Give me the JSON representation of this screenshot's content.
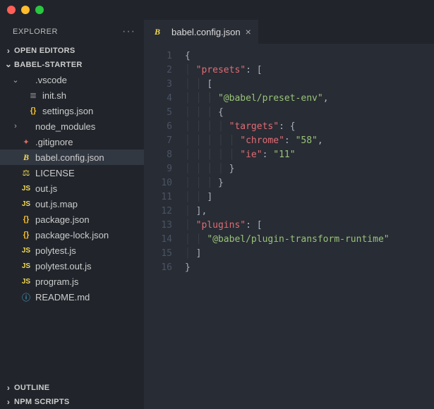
{
  "sidebar": {
    "title": "EXPLORER",
    "sections": {
      "open_editors": "OPEN EDITORS",
      "project": "BABEL-STARTER",
      "outline": "OUTLINE",
      "npm": "NPM SCRIPTS"
    },
    "tree": [
      {
        "name": ".vscode",
        "type": "folder",
        "expanded": true,
        "indent": 1
      },
      {
        "name": "init.sh",
        "type": "sh",
        "indent": 2
      },
      {
        "name": "settings.json",
        "type": "json",
        "indent": 2
      },
      {
        "name": "node_modules",
        "type": "folder",
        "expanded": false,
        "indent": 1
      },
      {
        "name": ".gitignore",
        "type": "git",
        "indent": 1
      },
      {
        "name": "babel.config.json",
        "type": "babel",
        "indent": 1,
        "selected": true
      },
      {
        "name": "LICENSE",
        "type": "license",
        "indent": 1
      },
      {
        "name": "out.js",
        "type": "js",
        "indent": 1
      },
      {
        "name": "out.js.map",
        "type": "js",
        "indent": 1
      },
      {
        "name": "package.json",
        "type": "json",
        "indent": 1
      },
      {
        "name": "package-lock.json",
        "type": "json",
        "indent": 1
      },
      {
        "name": "polytest.js",
        "type": "js",
        "indent": 1
      },
      {
        "name": "polytest.out.js",
        "type": "js",
        "indent": 1
      },
      {
        "name": "program.js",
        "type": "js",
        "indent": 1
      },
      {
        "name": "README.md",
        "type": "info",
        "indent": 1
      }
    ]
  },
  "tab": {
    "label": "babel.config.json"
  },
  "code": {
    "line_count": 16,
    "tokens": [
      [
        {
          "t": "{",
          "c": "punct"
        }
      ],
      [
        {
          "t": "  ",
          "c": "guide"
        },
        {
          "t": "\"presets\"",
          "c": "keyq"
        },
        {
          "t": ": [",
          "c": "punct"
        }
      ],
      [
        {
          "t": "    ",
          "c": "guide"
        },
        {
          "t": "[",
          "c": "punct"
        }
      ],
      [
        {
          "t": "      ",
          "c": "guide"
        },
        {
          "t": "\"@babel/preset-env\"",
          "c": "strq"
        },
        {
          "t": ",",
          "c": "punct"
        }
      ],
      [
        {
          "t": "      ",
          "c": "guide"
        },
        {
          "t": "{",
          "c": "punct"
        }
      ],
      [
        {
          "t": "        ",
          "c": "guide"
        },
        {
          "t": "\"targets\"",
          "c": "keyq"
        },
        {
          "t": ": {",
          "c": "punct"
        }
      ],
      [
        {
          "t": "          ",
          "c": "guide"
        },
        {
          "t": "\"chrome\"",
          "c": "keyq"
        },
        {
          "t": ": ",
          "c": "punct"
        },
        {
          "t": "\"58\"",
          "c": "strq"
        },
        {
          "t": ",",
          "c": "punct"
        }
      ],
      [
        {
          "t": "          ",
          "c": "guide"
        },
        {
          "t": "\"ie\"",
          "c": "keyq"
        },
        {
          "t": ": ",
          "c": "punct"
        },
        {
          "t": "\"11\"",
          "c": "strq"
        }
      ],
      [
        {
          "t": "        ",
          "c": "guide"
        },
        {
          "t": "}",
          "c": "punct"
        }
      ],
      [
        {
          "t": "      ",
          "c": "guide"
        },
        {
          "t": "}",
          "c": "punct"
        }
      ],
      [
        {
          "t": "    ",
          "c": "guide"
        },
        {
          "t": "]",
          "c": "punct"
        }
      ],
      [
        {
          "t": "  ",
          "c": "guide"
        },
        {
          "t": "],",
          "c": "punct"
        }
      ],
      [
        {
          "t": "  ",
          "c": "guide"
        },
        {
          "t": "\"plugins\"",
          "c": "keyq"
        },
        {
          "t": ": [",
          "c": "punct"
        }
      ],
      [
        {
          "t": "    ",
          "c": "guide"
        },
        {
          "t": "\"@babel/plugin-transform-runtime\"",
          "c": "strq"
        }
      ],
      [
        {
          "t": "  ",
          "c": "guide"
        },
        {
          "t": "]",
          "c": "punct"
        }
      ],
      [
        {
          "t": "}",
          "c": "punct"
        }
      ]
    ]
  }
}
